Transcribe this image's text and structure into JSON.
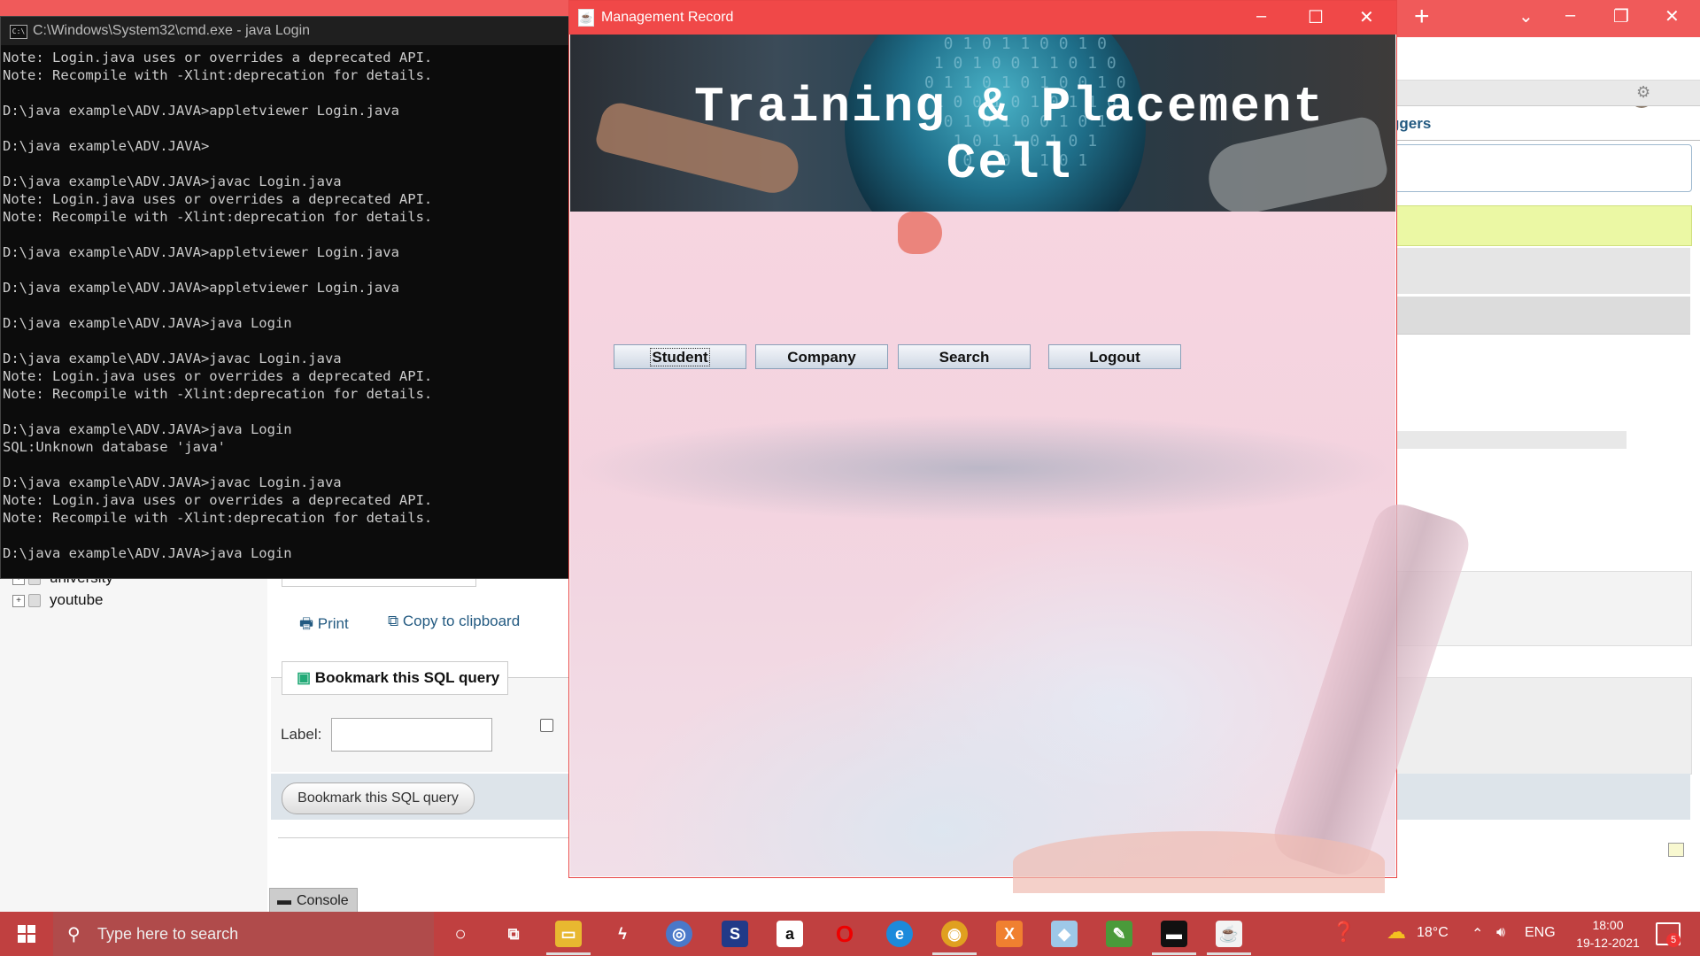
{
  "cmd": {
    "title": "C:\\Windows\\System32\\cmd.exe - java  Login",
    "lines": [
      "Note: Login.java uses or overrides a deprecated API.",
      "Note: Recompile with -Xlint:deprecation for details.",
      "",
      "D:\\java example\\ADV.JAVA>appletviewer Login.java",
      "",
      "D:\\java example\\ADV.JAVA>",
      "",
      "D:\\java example\\ADV.JAVA>javac Login.java",
      "Note: Login.java uses or overrides a deprecated API.",
      "Note: Recompile with -Xlint:deprecation for details.",
      "",
      "D:\\java example\\ADV.JAVA>appletviewer Login.java",
      "",
      "D:\\java example\\ADV.JAVA>appletviewer Login.java",
      "",
      "D:\\java example\\ADV.JAVA>java Login",
      "",
      "D:\\java example\\ADV.JAVA>javac Login.java",
      "Note: Login.java uses or overrides a deprecated API.",
      "Note: Recompile with -Xlint:deprecation for details.",
      "",
      "D:\\java example\\ADV.JAVA>java Login",
      "SQL:Unknown database 'java'",
      "",
      "D:\\java example\\ADV.JAVA>javac Login.java",
      "Note: Login.java uses or overrides a deprecated API.",
      "Note: Recompile with -Xlint:deprecation for details.",
      "",
      "D:\\java example\\ADV.JAVA>java Login"
    ]
  },
  "app": {
    "title": "Management Record",
    "banner": "Training & Placement Cell",
    "buttons": {
      "student": "Student",
      "company": "Company",
      "search": "Search",
      "logout": "Logout"
    }
  },
  "pma": {
    "tree": {
      "item_partial": "university",
      "item_youtube": "youtube"
    },
    "print": "Print",
    "copy": "Copy to clipboard",
    "bookmark_header": "Bookmark this SQL query",
    "label": "Label:",
    "bookmark_button": "Bookmark this SQL query",
    "console": "Console",
    "tab_partial": "ggers"
  },
  "taskbar": {
    "search_placeholder": "Type here to search",
    "temperature": "18°C",
    "language": "ENG",
    "time": "18:00",
    "date": "19-12-2021",
    "notifications": "5"
  },
  "colors": {
    "title_bar": "#f04848",
    "taskbar": "#c04040",
    "content_bg": "#f7d5e0"
  }
}
